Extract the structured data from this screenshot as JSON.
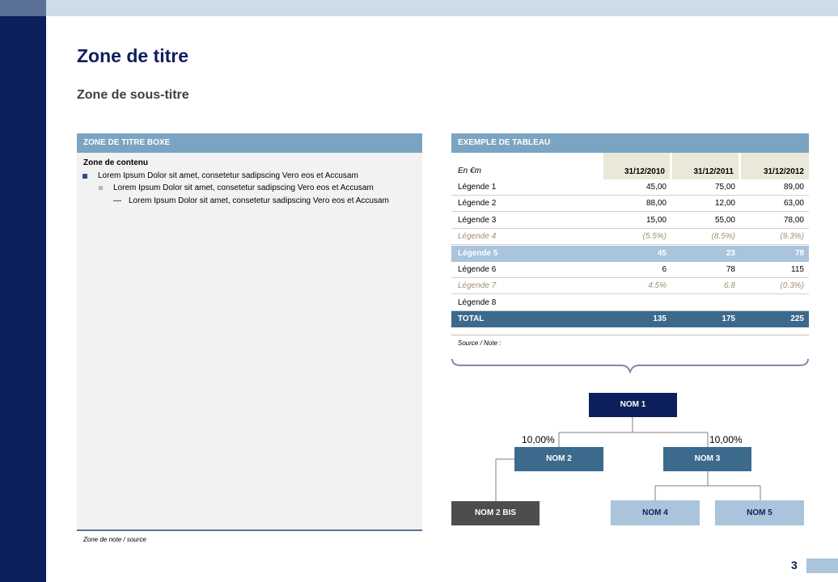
{
  "title": "Zone de titre",
  "subtitle": "Zone de sous-titre",
  "text_box": {
    "header": "ZONE DE TITRE BOXE",
    "content_heading": "Zone de contenu",
    "bullets": [
      "Lorem Ipsum Dolor sit amet, consetetur sadipscing Vero eos et Accusam",
      "Lorem Ipsum Dolor sit amet, consetetur sadipscing Vero eos et Accusam",
      "Lorem Ipsum Dolor sit amet, consetetur sadipscing Vero eos et Accusam"
    ],
    "dash": "—",
    "note": "Zone de note / source"
  },
  "table": {
    "header": "EXEMPLE DE TABLEAU",
    "unit": "En €m",
    "columns": [
      "31/12/2010",
      "31/12/2011",
      "31/12/2012"
    ],
    "rows": [
      {
        "label": "Légende 1",
        "values": [
          "45,00",
          "75,00",
          "89,00"
        ]
      },
      {
        "label": "Légende 2",
        "values": [
          "88,00",
          "12,00",
          "63,00"
        ]
      },
      {
        "label": "Légende 3",
        "values": [
          "15,00",
          "55,00",
          "78,00"
        ]
      },
      {
        "label": "Légende 4",
        "values": [
          "(5.5%)",
          "(8.5%)",
          "(9.3%)"
        ]
      },
      {
        "label": "Légende 5",
        "values": [
          "45",
          "23",
          "78"
        ]
      },
      {
        "label": "Légende 6",
        "values": [
          "6",
          "78",
          "115"
        ]
      },
      {
        "label": "Légende 7",
        "values": [
          "4.5%",
          "6.8",
          "(0.3%)"
        ]
      },
      {
        "label": "Légende 8",
        "values": [
          "",
          "",
          ""
        ]
      },
      {
        "label": "TOTAL",
        "values": [
          "135",
          "175",
          "225"
        ]
      }
    ],
    "source": "Source / Note :"
  },
  "org_chart": {
    "nom1": "NOM 1",
    "nom2": "NOM 2",
    "nom3": "NOM 3",
    "nom2bis": "NOM 2 BIS",
    "nom4": "NOM 4",
    "nom5": "NOM 5",
    "pct_left": "10,00%",
    "pct_right": "10,00%"
  },
  "page_number": "3",
  "colors": {
    "navy": "#0c1f5c",
    "header_blue": "#7ba4c3",
    "highlight_blue": "#a9c4db",
    "total_blue": "#3c6a8c",
    "date_bg": "#eae8d8"
  }
}
